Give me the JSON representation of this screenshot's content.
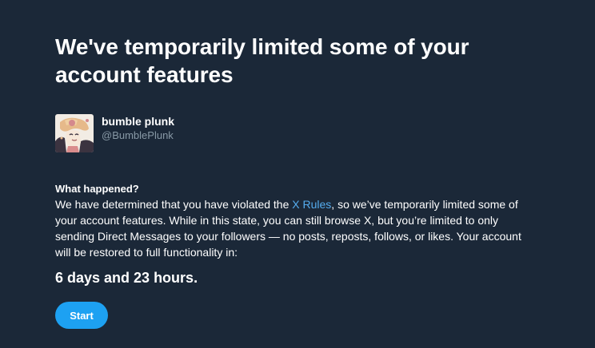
{
  "page": {
    "title": "We've temporarily limited some of your account features"
  },
  "account": {
    "display_name": "bumble plunk",
    "handle": "@BumblePlunk",
    "avatar_icon": "profile-avatar"
  },
  "notice": {
    "heading": "What happened?",
    "text_before_link": "We have determined that you have violated the ",
    "link_text": "X Rules",
    "text_after_link": ", so we’ve temporarily limited some of your account features. While in this state, you can still browse X, but you’re limited to only sending Direct Messages to your followers — no posts, reposts, follows, or likes. Your account will be restored to full functionality in:",
    "countdown": "6 days and 23 hours."
  },
  "actions": {
    "start_label": "Start"
  },
  "colors": {
    "background": "#1b2838",
    "text": "#ffffff",
    "secondary_text": "#8899a6",
    "link": "#55acee",
    "button": "#1da1f2"
  }
}
